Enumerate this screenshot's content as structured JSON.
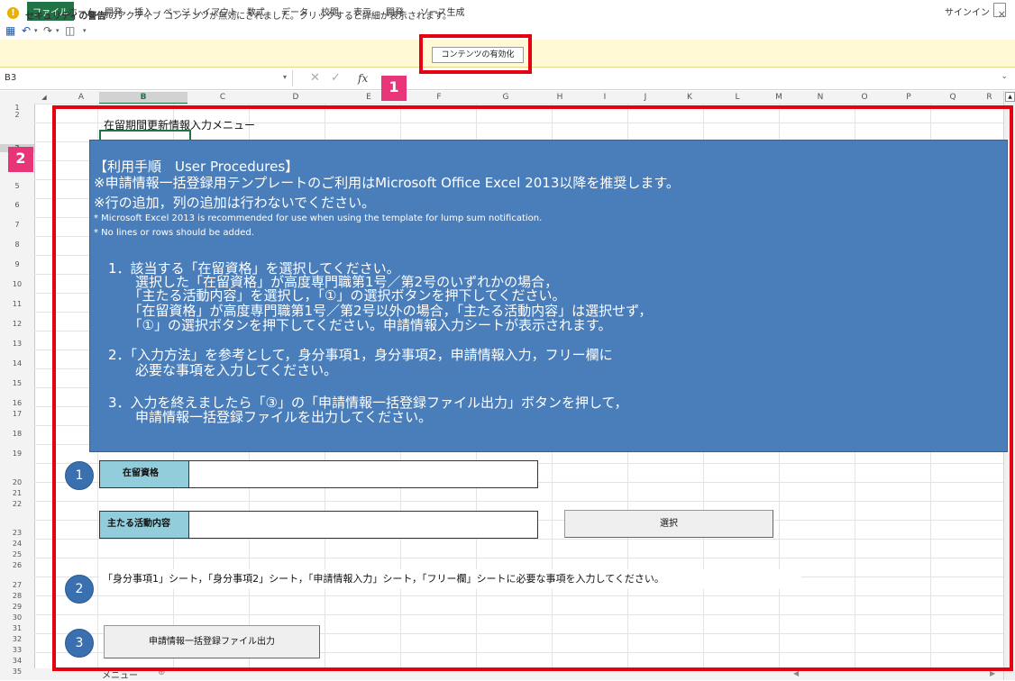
{
  "ribbon": {
    "tabs": [
      "ファイル",
      "ホーム",
      "開発",
      "挿入",
      "ページ レイアウト",
      "数式",
      "データ",
      "校閲",
      "表示",
      "開発",
      "ソース生成"
    ],
    "signin": "サインイン"
  },
  "security_bar": {
    "title": "セキュリティの警告",
    "message": "一部のアクティブ コンテンツが無効にされました。クリックすると詳細が表示されます。",
    "enable_button": "コンテンツの有効化",
    "close": "×"
  },
  "formula_bar": {
    "name_box": "B3",
    "fx": "fx"
  },
  "columns": [
    "A",
    "B",
    "C",
    "D",
    "E",
    "F",
    "G",
    "H",
    "I",
    "J",
    "K",
    "L",
    "M",
    "N",
    "O",
    "P",
    "Q",
    "R"
  ],
  "selected_column": "B",
  "rows": [
    "1",
    "2",
    "3",
    "4",
    "5",
    "6",
    "7",
    "8",
    "9",
    "10",
    "11",
    "12",
    "13",
    "14",
    "15",
    "16",
    "17",
    "18",
    "19",
    "20",
    "21",
    "22",
    "23",
    "24",
    "25",
    "26",
    "27",
    "28",
    "29",
    "30",
    "31",
    "32",
    "33",
    "34",
    "35"
  ],
  "sheet": {
    "menu_title": "在留期間更新情報入力メニュー",
    "instructions": {
      "heading": "【利用手順　User Procedures】",
      "line1": "※申請情報一括登録用テンプレートのご利用はMicrosoft Office Excel 2013以降を推奨します。",
      "line2": "※行の追加，列の追加は行わないでください。",
      "en1": "* Microsoft Excel 2013 is recommended for use when using the template for lump sum notification.",
      "en2": "* No lines or rows should be added.",
      "step1": [
        "1．該当する「在留資格」を選択してください。",
        "　　選択した「在留資格」が高度専門職第1号／第2号のいずれかの場合，",
        "　　「主たる活動内容」を選択し，「①」の選択ボタンを押下してください。",
        "　　「在留資格」が高度専門職第1号／第2号以外の場合，「主たる活動内容」は選択せず，",
        "　　「①」の選択ボタンを押下してください。申請情報入力シートが表示されます。"
      ],
      "step2": [
        "2．「入力方法」を参考として，身分事項1，身分事項2，申請情報入力，フリー欄に",
        "　　必要な事項を入力してください。"
      ],
      "step3": [
        "3．入力を終えましたら「③」の「申請情報一括登録ファイル出力」ボタンを押して，",
        "　　申請情報一括登録ファイルを出力してください。"
      ]
    },
    "circle1": "1",
    "circle2": "2",
    "circle3": "3",
    "status_label": "在留資格",
    "status_value": "",
    "activity_label": "主たる活動内容",
    "activity_value": "",
    "select_button": "選択",
    "note2": "「身分事項1」シート，「身分事項2」シート，「申請情報入力」シート，「フリー欄」シートに必要な事項を入力してください。",
    "output_button": "申請情報一括登録ファイル出力"
  },
  "sheet_tab": "メニュー",
  "annotations": {
    "marker1": "1",
    "marker2": "2"
  },
  "colors": {
    "excel_green": "#217346",
    "instruction_bg": "#4a7ebb",
    "label_bg": "#92cddc",
    "annotation_red": "#e60012",
    "marker_pink": "#e8357a"
  }
}
